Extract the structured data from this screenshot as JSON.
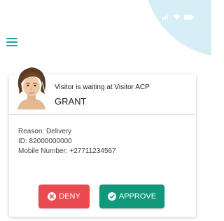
{
  "colors": {
    "accent": "#1ba39c",
    "deny": "#e84a50",
    "approve": "#11987a"
  },
  "status_bar": {
    "icons": [
      "signal-icon",
      "wifi-icon",
      "battery-icon"
    ]
  },
  "header": {
    "menu_icon": "hamburger-menu-icon"
  },
  "visitor_card": {
    "message": "Visitor is waiting at Visitor ACP",
    "name": "GRANT",
    "reason": "Reason: Delivery",
    "id": "ID: 82000000000",
    "mobile": "Mobile Number: +27711234567",
    "deny_label": "DENY",
    "approve_label": "APPROVE",
    "deny_icon": "close-circle-icon",
    "approve_icon": "check-circle-icon"
  }
}
